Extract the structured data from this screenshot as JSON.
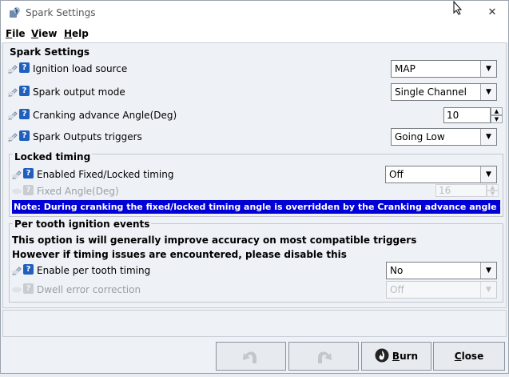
{
  "window": {
    "title": "Spark Settings",
    "close_glyph": "✕"
  },
  "menu": [
    {
      "label": "File",
      "mnemonic": "F",
      "rest": "ile"
    },
    {
      "label": "View",
      "mnemonic": "V",
      "rest": "iew"
    },
    {
      "label": "Help",
      "mnemonic": "H",
      "rest": "elp"
    }
  ],
  "spark_settings": {
    "title": "Spark Settings",
    "ignition_load_source": {
      "label": "Ignition load source",
      "value": "MAP"
    },
    "spark_output_mode": {
      "label": "Spark output mode",
      "value": "Single Channel"
    },
    "cranking_advance": {
      "label": "Cranking advance Angle(Deg)",
      "value": "10"
    },
    "spark_outputs_triggers": {
      "label": "Spark Outputs triggers",
      "value": "Going Low"
    }
  },
  "locked_timing": {
    "title": "Locked timing",
    "enabled": {
      "label": "Enabled Fixed/Locked timing",
      "value": "Off"
    },
    "fixed_angle": {
      "label": "Fixed Angle(Deg)",
      "value": "16"
    },
    "note": "Note: During cranking the fixed/locked timing angle is overridden by the Cranking advance angle value above"
  },
  "per_tooth": {
    "title": "Per tooth ignition events",
    "info1": "This option is will generally improve accuracy on most compatible triggers",
    "info2": "However if timing issues are encountered, please disable this",
    "enable": {
      "label": "Enable per tooth timing",
      "value": "No"
    },
    "dwell": {
      "label": "Dwell error correction",
      "value": "Off"
    }
  },
  "buttons": {
    "burn": {
      "mnemonic": "B",
      "rest": "urn"
    },
    "close": {
      "mnemonic": "C",
      "rest": "lose"
    }
  },
  "icons": {
    "app": "spark-app-icon",
    "edit": "pencil-icon",
    "help": "help-icon",
    "undo": "undo-icon",
    "redo": "redo-icon",
    "burn": "flame-icon"
  },
  "colors": {
    "note_bg": "#0000d6",
    "help_icon": "#1f5fbf"
  }
}
